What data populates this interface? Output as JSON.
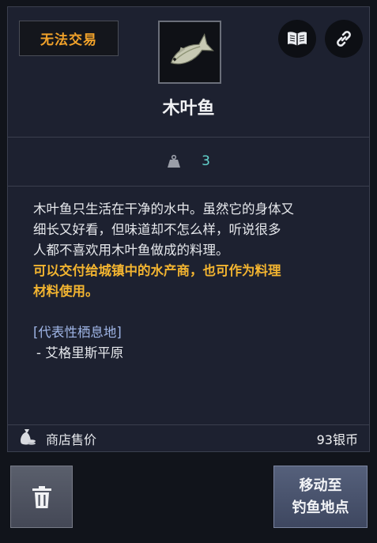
{
  "item": {
    "trade_status": "无法交易",
    "name": "木叶鱼",
    "icon": "fish-icon",
    "weight": "3"
  },
  "header_actions": [
    {
      "icon": "book-icon"
    },
    {
      "icon": "link-icon"
    }
  ],
  "description": {
    "lines": [
      "木叶鱼只生活在干净的水中。虽然它的身体又",
      "细长又好看，但味道却不怎么样，听说很多",
      "人都不喜欢用木叶鱼做成的料理。"
    ],
    "highlight_lines": [
      "可以交付给城镇中的水产商，也可作为料理",
      "材料使用。"
    ],
    "habitat_title": "[代表性栖息地]",
    "habitat_item": "- 艾格里斯平原"
  },
  "price": {
    "label": "商店售价",
    "value": "93银币",
    "icon": "money-bag-icon"
  },
  "buttons": {
    "delete_icon": "trash-icon",
    "move_line1": "移动至",
    "move_line2": "钓鱼地点"
  },
  "colors": {
    "panel_bg": "#1d2130",
    "trade_status": "#f0a12a",
    "weight_value": "#64d5cf",
    "highlight": "#f2b430",
    "habitat_title": "#9fb5e6"
  }
}
